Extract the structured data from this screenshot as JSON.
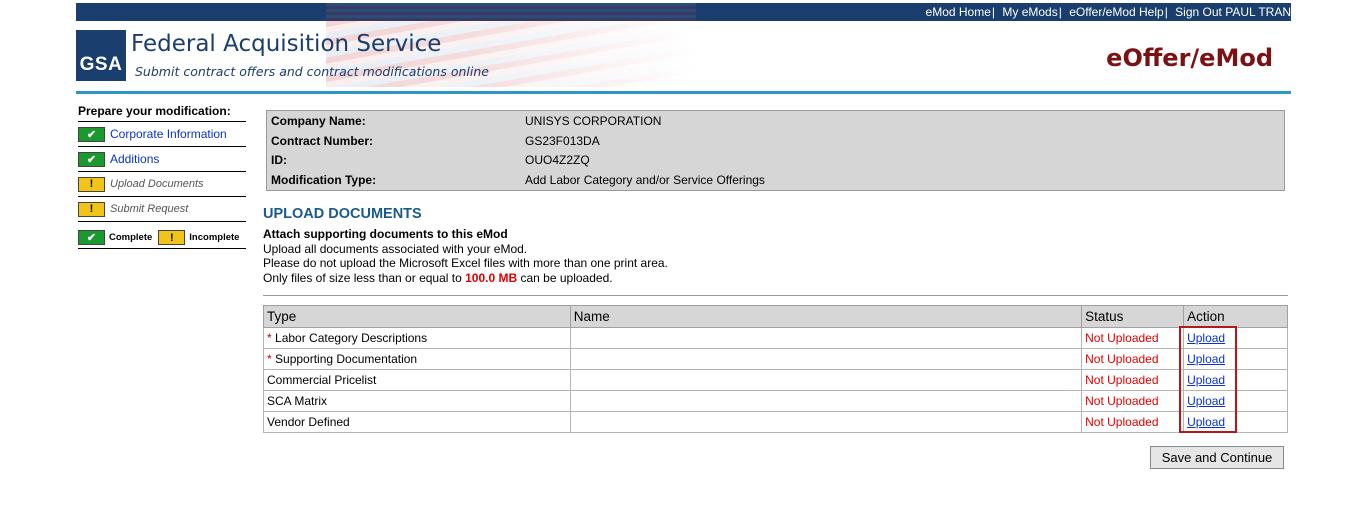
{
  "header": {
    "top_links": [
      "eMod Home",
      "My eMods",
      "eOffer/eMod Help",
      "Sign Out PAUL TRAN"
    ],
    "gsa_logo": "GSA",
    "title": "Federal Acquisition Service",
    "subtitle": "Submit contract offers and contract modifications online",
    "brand": "eOffer/eMod"
  },
  "sidebar": {
    "title": "Prepare your modification:",
    "items": [
      {
        "label": "Corporate Information",
        "status": "complete"
      },
      {
        "label": "Additions",
        "status": "complete"
      },
      {
        "label": "Upload Documents",
        "status": "incomplete"
      },
      {
        "label": "Submit Request",
        "status": "incomplete"
      }
    ],
    "legend": {
      "complete": "Complete",
      "incomplete": "Incomplete",
      "complete_icon": "check-icon",
      "incomplete_icon": "exclamation-icon"
    }
  },
  "info": {
    "rows": [
      {
        "label": "Company Name:",
        "value": "UNISYS CORPORATION"
      },
      {
        "label": "Contract Number:",
        "value": "GS23F013DA"
      },
      {
        "label": "ID:",
        "value": "OUO4Z2ZQ"
      },
      {
        "label": "Modification Type:",
        "value": "Add Labor Category and/or Service Offerings"
      }
    ]
  },
  "section": {
    "title": "UPLOAD DOCUMENTS",
    "heading": "Attach supporting documents to this eMod",
    "line1": "Upload all documents associated with your eMod.",
    "line2": "Please do not upload the Microsoft Excel files with more than one print area.",
    "line3_pre": "Only files of size less than or equal to",
    "line3_size": "100.0 MB",
    "line3_post": "can be uploaded."
  },
  "table": {
    "headers": [
      "Type",
      "Name",
      "Status",
      "Action"
    ],
    "rows": [
      {
        "required": true,
        "type": "Labor Category Descriptions",
        "name": "",
        "status": "Not Uploaded",
        "action": "Upload"
      },
      {
        "required": true,
        "type": "Supporting Documentation",
        "name": "",
        "status": "Not Uploaded",
        "action": "Upload"
      },
      {
        "required": false,
        "type": "Commercial Pricelist",
        "name": "",
        "status": "Not Uploaded",
        "action": "Upload"
      },
      {
        "required": false,
        "type": "SCA Matrix",
        "name": "",
        "status": "Not Uploaded",
        "action": "Upload"
      },
      {
        "required": false,
        "type": "Vendor Defined",
        "name": "",
        "status": "Not Uploaded",
        "action": "Upload"
      }
    ],
    "required_marker": "*"
  },
  "buttons": {
    "save": "Save and Continue"
  },
  "colors": {
    "navy": "#1a3e6e",
    "accent_rule": "#2c96c4",
    "brand": "#7b1113",
    "status_red": "#e00000",
    "link": "#0b32c8",
    "complete": "#1a9a2c",
    "incomplete": "#f2c318"
  }
}
